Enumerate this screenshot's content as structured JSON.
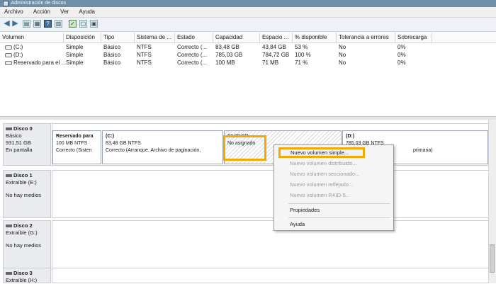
{
  "window": {
    "title": "Administración de discos"
  },
  "menu": [
    "Archivo",
    "Acción",
    "Ver",
    "Ayuda"
  ],
  "volume_list": {
    "columns": [
      "Volumen",
      "Disposición",
      "Tipo",
      "Sistema de ...",
      "Estado",
      "Capacidad",
      "Espacio ...",
      "% disponible",
      "Tolerancia a errores",
      "Sobrecarga"
    ],
    "rows": [
      [
        "(C:)",
        "Simple",
        "Básico",
        "NTFS",
        "Correcto (...",
        "83,48 GB",
        "43,84 GB",
        "53 %",
        "No",
        "0%"
      ],
      [
        "(D:)",
        "Simple",
        "Básico",
        "NTFS",
        "Correcto (...",
        "785,03 GB",
        "784,72 GB",
        "100 %",
        "No",
        "0%"
      ],
      [
        "Reservado para el ...",
        "Simple",
        "Básico",
        "NTFS",
        "Correcto (...",
        "100 MB",
        "71 MB",
        "71 %",
        "No",
        "0%"
      ]
    ]
  },
  "disks": [
    {
      "name": "Disco 0",
      "type": "Básico",
      "size": "931,51 GB",
      "status": "En pantalla",
      "partitions": [
        {
          "title": "Reservado para",
          "line1": "100 MB NTFS",
          "line2": "Correcto (Sisten"
        },
        {
          "title": "(C:)",
          "line1": "83,48 GB NTFS",
          "line2": "Correcto (Arranque, Archivo de paginación,"
        },
        {
          "title": "",
          "line1": "62,90 GB",
          "line2": "No asignado"
        },
        {
          "title": "(D:)",
          "line1": "785,03 GB NTFS",
          "line2": "primaria)"
        }
      ]
    },
    {
      "name": "Disco 1",
      "type": "Extraíble (E:)",
      "status": "No hay medios"
    },
    {
      "name": "Disco 2",
      "type": "Extraíble (G:)",
      "status": "No hay medios"
    },
    {
      "name": "Disco 3",
      "type": "Extraíble (H:)"
    }
  ],
  "context_menu": {
    "items": [
      "Nuevo volumen simple...",
      "Nuevo volumen distribuido...",
      "Nuevo volumen seccionado...",
      "Nuevo volumen reflejado...",
      "Nuevo volumen RAID-5...",
      "Propiedades",
      "Ayuda"
    ]
  },
  "colors": {
    "primary_partition": "#1f3a93",
    "unallocated": "#111111",
    "highlight": "#f5a800"
  }
}
